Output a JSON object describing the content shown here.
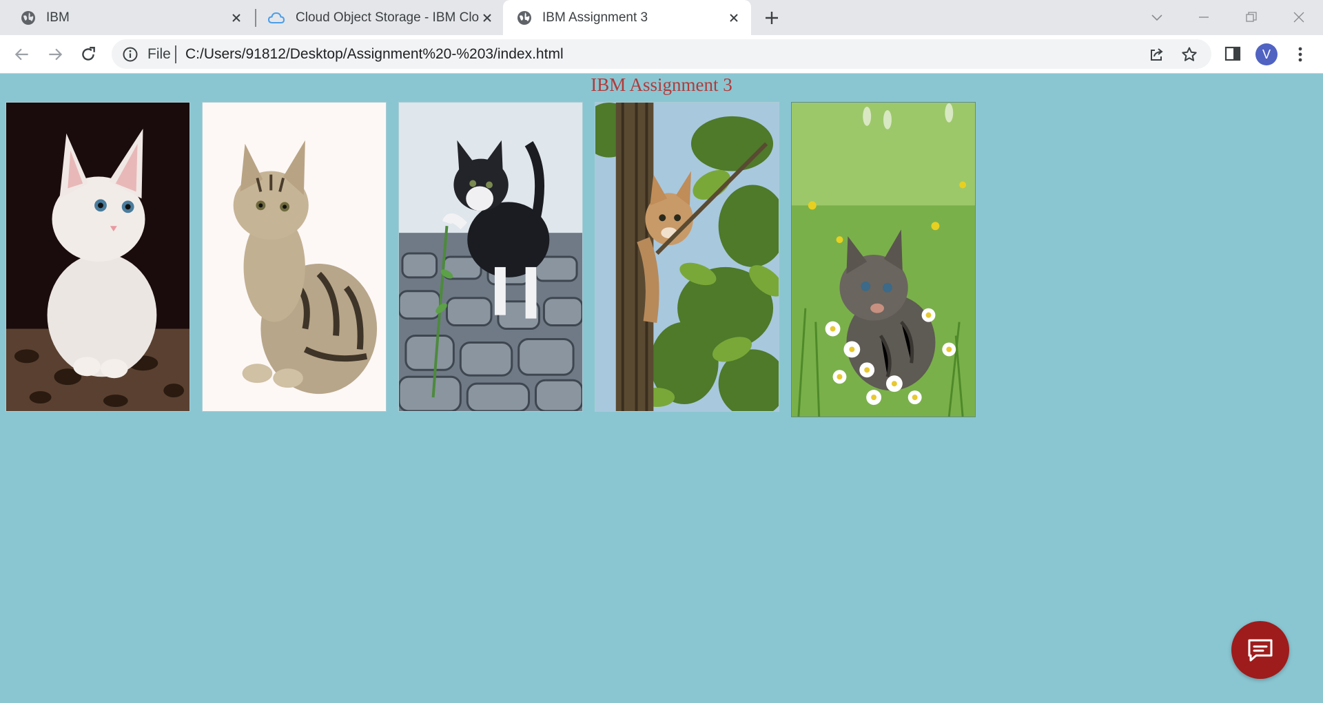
{
  "tabs": [
    {
      "title": "IBM",
      "favicon": "globe-icon",
      "active": false
    },
    {
      "title": "Cloud Object Storage - IBM Clou",
      "favicon": "cloud-icon",
      "active": false
    },
    {
      "title": "IBM Assignment 3",
      "favicon": "globe-icon",
      "active": true
    }
  ],
  "toolbar": {
    "scheme_label": "File",
    "url": "C:/Users/91812/Desktop/Assignment%20-%203/index.html",
    "avatar_initial": "V"
  },
  "page": {
    "heading": "IBM Assignment 3",
    "images": [
      {
        "subject": "white kitten on leopard-print blanket"
      },
      {
        "subject": "striped tabby kitten sitting on white"
      },
      {
        "subject": "black and white kitten on cobblestones with a plant"
      },
      {
        "subject": "kitten climbing a tree trunk among leaves"
      },
      {
        "subject": "grey kitten in grass with daisies"
      }
    ]
  },
  "colors": {
    "page_background": "#8ac6d2",
    "heading": "#b23a3a",
    "chat_button": "#9e1c1c",
    "avatar": "#5063c2"
  }
}
